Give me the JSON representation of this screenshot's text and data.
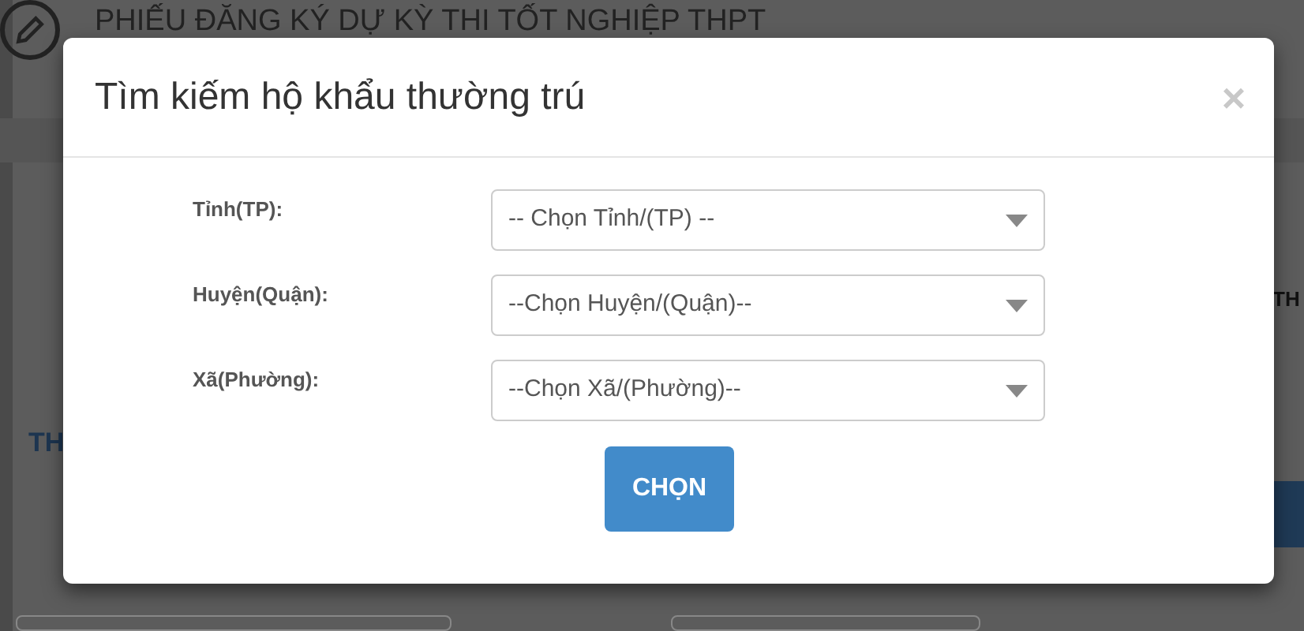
{
  "background_page": {
    "title": "PHIẾU ĐĂNG KÝ DỰ KỲ THI TỐT NGHIỆP THPT",
    "fragment_right": "TH",
    "fragment_left": "TH"
  },
  "modal": {
    "title": "Tìm kiếm hộ khẩu thường trú",
    "close": "×",
    "fields": [
      {
        "label": "Tỉnh(TP):",
        "placeholder": "-- Chọn Tỉnh/(TP) --"
      },
      {
        "label": "Huyện(Quận):",
        "placeholder": "--Chọn Huyện/(Quận)--"
      },
      {
        "label": "Xã(Phường):",
        "placeholder": "--Chọn Xã/(Phường)--"
      }
    ],
    "button": "CHỌN"
  }
}
